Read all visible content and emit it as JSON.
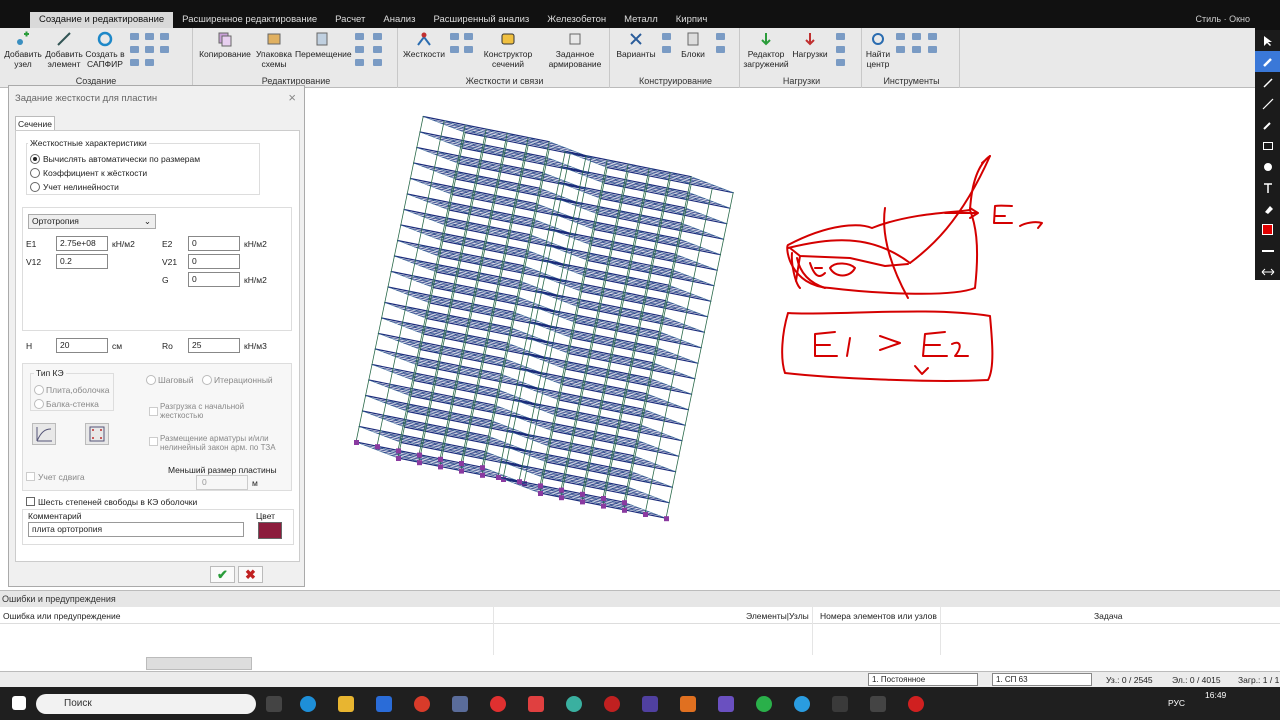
{
  "ribbon_tabs": [
    "Создание и редактирование",
    "Расширенное редактирование",
    "Расчет",
    "Анализ",
    "Расширенный анализ",
    "Железобетон",
    "Металл",
    "Кирпич"
  ],
  "top_right": {
    "style": "Стиль",
    "window": "Окно"
  },
  "groups": {
    "create": {
      "name": "Создание",
      "btn1": "Добавить\nузел",
      "btn2": "Добавить\nэлемент",
      "btn3": "Создать в\nСАПФИР"
    },
    "edit": {
      "name": "Редактирование",
      "btn1": "Копирование",
      "btn2": "Упаковка\nсхемы",
      "btn3": "Перемещение"
    },
    "stiff": {
      "name": "Жесткости и связи",
      "btn1": "Жесткости",
      "btn2": "Конструктор\nсечений",
      "btn3": "Заданное\nармирование"
    },
    "design": {
      "name": "Конструирование",
      "btn1": "Варианты",
      "btn2": "Блоки"
    },
    "loads": {
      "name": "Нагрузки",
      "btn1": "Редактор\nзагружений",
      "btn2": "Нагрузки"
    },
    "tools": {
      "name": "Инструменты",
      "btn1": "Найти\nцентр"
    }
  },
  "dialog": {
    "title": "Задание жесткости для пластин",
    "tab": "Сечение",
    "stiff_group": "Жесткостные характеристики",
    "radio_auto": "Вычислять автоматически по размерам",
    "radio_coef": "Коэффициент к жёсткости",
    "radio_nonlin": "Учет нелинейности",
    "material_type": "Ортотропия",
    "e1_label": "E1",
    "e1": "2.75e+08",
    "e1_unit": "кН/м2",
    "e2_label": "E2",
    "e2": "0",
    "e2_unit": "кН/м2",
    "v12_label": "V12",
    "v12": "0.2",
    "v21_label": "V21",
    "v21": "0",
    "g_label": "G",
    "g": "0",
    "g_unit": "кН/м2",
    "h_label": "H",
    "h": "20",
    "h_unit": "см",
    "ro_label": "Ro",
    "ro": "25",
    "ro_unit": "кН/м3",
    "fe_type": "Тип КЭ",
    "fe_plate": "Плита,оболочка",
    "fe_beam": "Балка-стенка",
    "step": "Шаговый",
    "iter": "Итерационный",
    "unload": "Разгрузка с начальной\nжесткостью",
    "rebar": "Размещение арматуры и/или\nнелинейный закон арм. по ТЗА",
    "shear": "Учет сдвига",
    "min_size_label": "Меньший размер пластины",
    "min_size": "0",
    "min_size_unit": "м",
    "six_dof": "Шесть степеней свободы в КЭ оболочки",
    "comment_label": "Комментарий",
    "comment": "плита ортотропия",
    "color_label": "Цвет",
    "ok": "✔",
    "cancel": "✖"
  },
  "errors": {
    "header": "Ошибки и предупреждения",
    "col1": "Ошибка или предупреждение",
    "col2": "Элементы|Узлы",
    "col3": "Номера элементов или узлов",
    "col4": "Задача"
  },
  "status": {
    "load_case": "1. Постоянное",
    "rule": "1. СП 63",
    "nodes": "Уз.: 0 / 2545",
    "elems": "Эл.: 0 / 4015",
    "loads": "Загр.: 1 / 1"
  },
  "taskbar": {
    "search": "Поиск",
    "lang": "РУС",
    "time": "16:49"
  },
  "colors": {
    "accent": "#8c1c3c",
    "sketch": "#d40000",
    "frame": "#1a2a7a"
  }
}
